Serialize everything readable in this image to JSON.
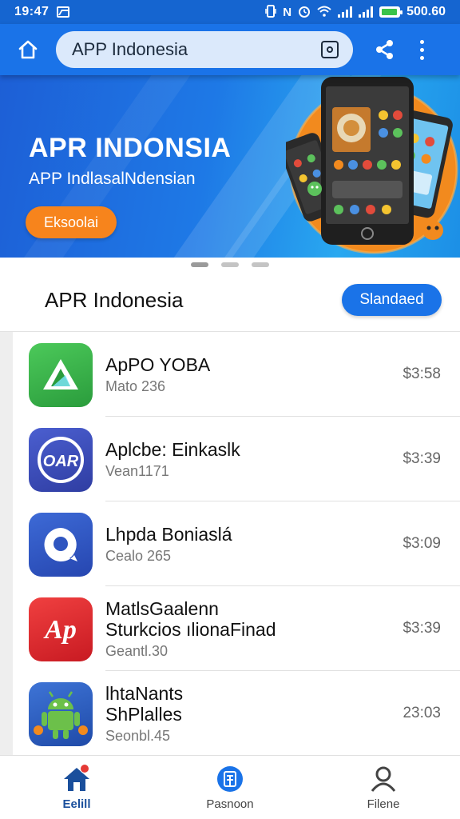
{
  "status_bar": {
    "time": "19:47",
    "battery_text": "500.60",
    "battery_level": 0.85,
    "battery_color": "#3ac34a",
    "icons": [
      "gallery-icon",
      "vibrate-icon",
      "nfc-icon",
      "alarm-icon",
      "wifi-icon",
      "signal-icon",
      "signal-icon",
      "battery-icon"
    ]
  },
  "app_bar": {
    "search_text": "APP Indonesia",
    "icons": [
      "home-icon",
      "scan-icon",
      "share-icon",
      "more-vert-icon"
    ],
    "color": "#1a73e8"
  },
  "banner": {
    "title": "APR INDONSIA",
    "subtitle": "APP IndlasalNdensian",
    "button_label": "Eksoolai",
    "button_color": "#f7841c"
  },
  "pager": {
    "count": 3,
    "active_index": 0
  },
  "section": {
    "title": "APR Indonesia",
    "button_label": "Slandaed"
  },
  "apps": [
    {
      "name": "ApPO YOBA",
      "sub": "Mato 236",
      "price": "$3:58",
      "icon": "triangle-logo-icon",
      "color": "#34b24a"
    },
    {
      "name": "Aplcbe: Einkaslk",
      "sub": "Vean1171",
      "price": "$3:39",
      "icon": "oar-logo-icon",
      "color": "#3c4fb8"
    },
    {
      "name": "Lhpda Boniaslá",
      "sub": "Cealo 265",
      "price": "$3:09",
      "icon": "speech-bubble-icon",
      "color": "#3157c4"
    },
    {
      "name": "MatlsGaalenn",
      "name2": "Sturkcios ılionaFinad",
      "sub": "Geantl.30",
      "price": "$3:39",
      "icon": "ap-logo-icon",
      "color": "#e2272b"
    },
    {
      "name": "lhtaNants",
      "name2": "ShPlalles",
      "sub": "Seonbl.45",
      "price": "23:03",
      "icon": "android-robot-icon",
      "color": "#2f5fbf"
    }
  ],
  "bottom_nav": {
    "items": [
      {
        "label": "Eelill",
        "icon": "home-icon",
        "active": true,
        "badge": true
      },
      {
        "label": "Pasnoon",
        "icon": "app-store-icon",
        "active": false,
        "badge": false
      },
      {
        "label": "Filene",
        "icon": "person-icon",
        "active": false,
        "badge": false
      }
    ]
  }
}
